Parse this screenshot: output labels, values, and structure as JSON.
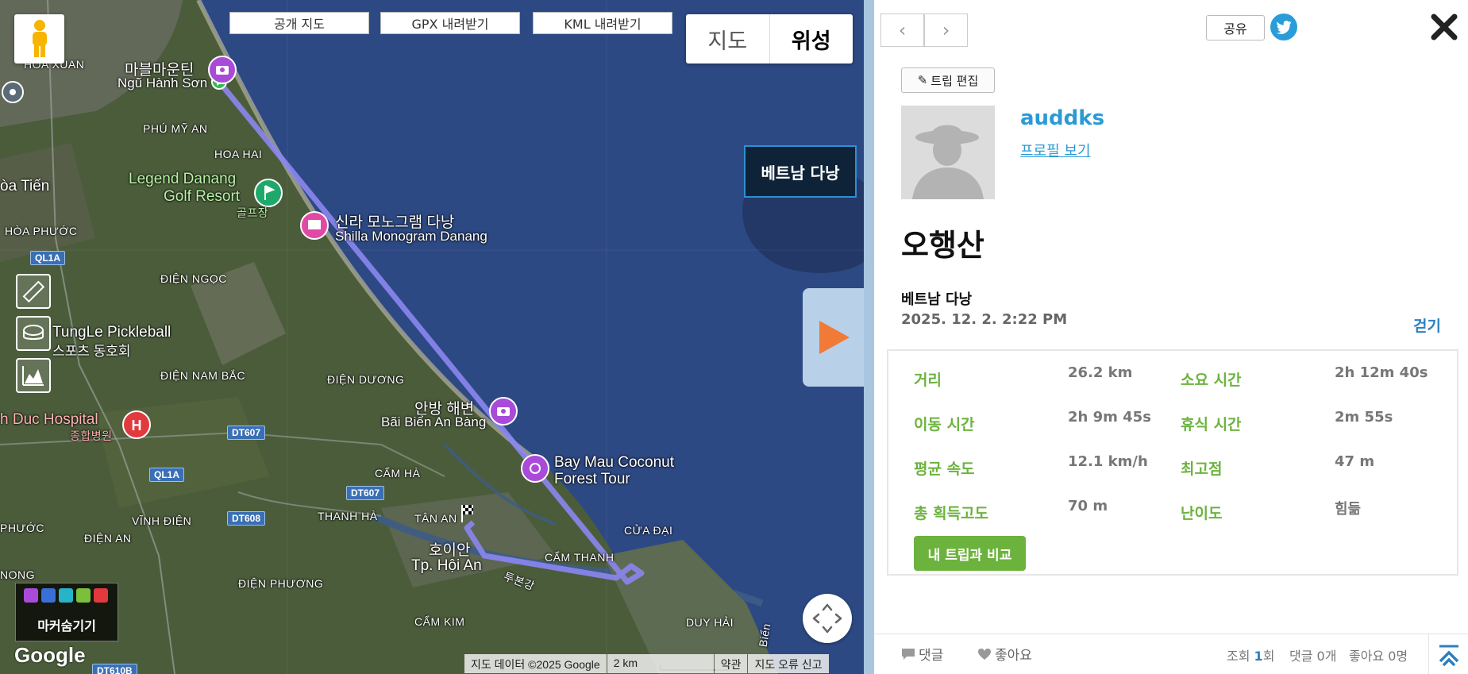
{
  "map": {
    "buttons": {
      "public_map": "공개 지도",
      "gpx_download": "GPX 내려받기",
      "kml_download": "KML 내려받기"
    },
    "map_type": {
      "map": "지도",
      "satellite": "위성",
      "selected": "위성"
    },
    "place_tag": "베트남 다낭",
    "labels": {
      "hoa_xuan": "HOA XUAN",
      "marble_mountains_ko": "마블마운틴",
      "ngu_hanh_son": "Ngũ Hành Sơn",
      "phu_my_an": "PHÚ MỸ AN",
      "hoa_hai": "HOA HAI",
      "legend_golf_1": "Legend Danang",
      "legend_golf_2": "Golf Resort",
      "golf_ko": "골프장",
      "ba_tien": "òa Tiến",
      "hoa_phuoc": "HÒA PHƯỚC",
      "shilla_ko": "신라 모노그램 다낭",
      "shilla_en": "Shilla Monogram Danang",
      "dien_ngoc": "ĐIỆN NGỌC",
      "tungle_1": "TungLe Pickleball",
      "tungle_2": "스포츠 동호회",
      "dien_nam_bac": "ĐIỆN NAM BẮC",
      "dien_duong": "ĐIỆN DƯƠNG",
      "anbang_ko": "안방 해변",
      "anbang_en": "Bãi Biển An Bàng",
      "hospital_en": "h Duc Hospital",
      "hospital_ko": "종합병원",
      "coconut_1": "Bay Mau Coconut",
      "coconut_2": "Forest Tour",
      "cam_ha": "CẨM HÀ",
      "tan_an": "TÂN AN",
      "vinh_dien": "VĨNH ĐIỆN",
      "thanh_ha": "THANH HÀ",
      "phuoc": "PHƯỚC",
      "hoian_ko": "호이안",
      "hoian_en": "Tp. Hội An",
      "cam_thanh": "CẨM THANH",
      "cua_dai": "CỬA ĐẠI",
      "dien_an": "ĐIỆN AN",
      "nong": "NONG",
      "dien_phuong": "ĐIỆN PHƯƠNG",
      "thu_bon": "투본강",
      "cam_kim": "CẨM KIM",
      "duy_hai": "DUY HẢI",
      "bien": "Biển"
    },
    "roads": {
      "ql1a_1": "QL1A",
      "ql1a_2": "QL1A",
      "dt607_1": "DT607",
      "dt607_2": "DT607",
      "dt608": "DT608",
      "dt610b": "DT610B"
    },
    "marker_toggle_label": "마커숨기기",
    "google_logo": "Google",
    "attribution": {
      "data": "지도 데이터 ©2025 Google",
      "scale": "2 km",
      "terms": "약관",
      "report": "지도 오류 신고"
    },
    "colors": {
      "track": "#8b86f0",
      "ocean": "#2e4a86",
      "land": "#4a5d3a"
    }
  },
  "panel": {
    "share": "공유",
    "edit_trip": "트립 편집",
    "username": "auddks",
    "profile_link": "프로필 보기",
    "title": "오행산",
    "location": "베트남 다낭",
    "date": "2025. 12. 2. 2:22 PM",
    "activity": "걷기",
    "stats": [
      {
        "label": "거리",
        "value": "26.2 km"
      },
      {
        "label": "소요 시간",
        "value": "2h 12m 40s"
      },
      {
        "label": "이동 시간",
        "value": "2h 9m 45s"
      },
      {
        "label": "휴식 시간",
        "value": "2m 55s"
      },
      {
        "label": "평균 속도",
        "value": "12.1 km/h"
      },
      {
        "label": "최고점",
        "value": "47 m"
      },
      {
        "label": "총 획득고도",
        "value": "70 m"
      },
      {
        "label": "난이도",
        "value": "힘듦"
      }
    ],
    "compare_button": "내 트립과 비교",
    "footer": {
      "comment": "댓글",
      "like": "좋아요",
      "views_label": "조회",
      "views_count": "1",
      "views_unit": "회",
      "comments_count": "댓글 0개",
      "likes_count": "좋아요 0명"
    },
    "colors": {
      "accent_blue": "#2b9ad6",
      "accent_green": "#6cb33e"
    }
  }
}
